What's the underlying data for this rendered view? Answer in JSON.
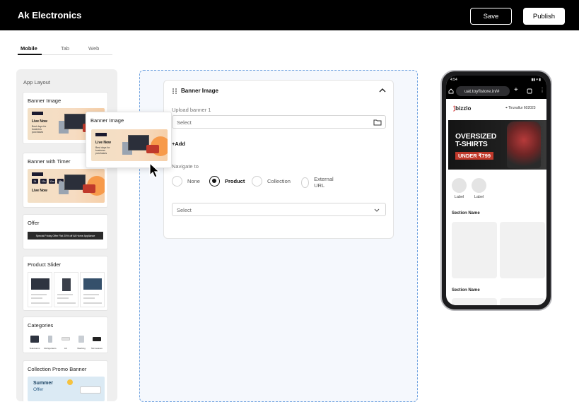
{
  "header": {
    "title": "Ak Electronics",
    "save_label": "Save",
    "publish_label": "Publish"
  },
  "tabs": [
    {
      "label": "Mobile",
      "active": true
    },
    {
      "label": "Tab",
      "active": false
    },
    {
      "label": "Web",
      "active": false
    }
  ],
  "sidebar": {
    "title": "App Layout",
    "items": [
      {
        "label": "Banner Image"
      },
      {
        "label": "Banner with Timer"
      },
      {
        "label": "Offer"
      },
      {
        "label": "Product Slider"
      },
      {
        "label": "Categories"
      },
      {
        "label": "Collection Promo Banner"
      }
    ],
    "banner_thumb": {
      "headline": "Live Now",
      "sub": "Best days for business purchases"
    },
    "timer_thumb": {
      "digits": [
        "24",
        "12h",
        "12m",
        "38s"
      ],
      "headline": "Live Now"
    },
    "offer_thumb": {
      "text": "Special Friday Offer Flat 25% off All Home Appliance"
    },
    "categories_thumb": [
      "Televisions",
      "Refrigerators",
      "AC",
      "Washing",
      "Microwaves"
    ],
    "promo_thumb": {
      "line1": "Summer",
      "line2": "Offer"
    }
  },
  "drag_ghost": {
    "label": "Banner Image",
    "headline": "Live Now",
    "sub": "Best days for business purchases"
  },
  "editor": {
    "title": "Banner Image",
    "upload_label": "Upload banner 1",
    "upload_placeholder": "Select",
    "add_label": "+Add",
    "navigate_label": "Navigate to",
    "options": [
      {
        "label": "None",
        "selected": false
      },
      {
        "label": "Product",
        "selected": true
      },
      {
        "label": "Collection",
        "selected": false
      },
      {
        "label": "External URL",
        "selected": false
      }
    ],
    "target_placeholder": "Select"
  },
  "phone": {
    "time": "4:54",
    "url": "uat.toyfistore.in/#",
    "brand": "bizzlo",
    "location": "Tiruvallur 602023",
    "hero": {
      "line1": "OVERSIZED",
      "line2": "T-SHIRTS",
      "price": "UNDER ₹799"
    },
    "circle_labels": [
      "Label",
      "Label"
    ],
    "section_titles": [
      "Section Name",
      "Section Name"
    ]
  },
  "colors": {
    "topbar": "#000000",
    "canvas_border": "#6fa2e0",
    "accent_orange": "#f79a4a"
  }
}
